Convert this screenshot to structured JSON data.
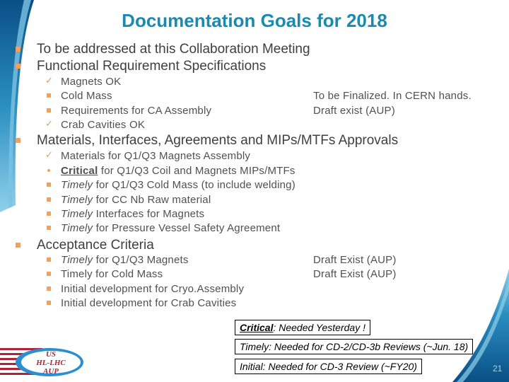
{
  "title": "Documentation Goals for 2018",
  "sections": [
    {
      "label": "To be addressed at this Collaboration Meeting",
      "bullet": "square"
    },
    {
      "label": "Functional Requirement Specifications",
      "bullet": "square",
      "items": [
        {
          "bullet": "check",
          "text": "Magnets OK",
          "note": ""
        },
        {
          "bullet": "square",
          "text": "Cold Mass",
          "note": "To be Finalized. In CERN hands."
        },
        {
          "bullet": "square",
          "text": "Requirements for CA Assembly",
          "note": "Draft exist (AUP)"
        },
        {
          "bullet": "check",
          "text": "Crab Cavities OK",
          "note": ""
        }
      ]
    },
    {
      "label": "Materials, Interfaces, Agreements and MIPs/MTFs Approvals",
      "bullet": "square",
      "items": [
        {
          "bullet": "check",
          "prefix": "",
          "text": "Materials for Q1/Q3 Magnets Assembly"
        },
        {
          "bullet": "dot",
          "prefix": "Critical",
          "prefix_style": "bold-underline",
          "text": " for Q1/Q3 Coil and Magnets MIPs/MTFs"
        },
        {
          "bullet": "square",
          "prefix": "Timely",
          "prefix_style": "italic",
          "text": " for Q1/Q3 Cold Mass (to include welding)"
        },
        {
          "bullet": "square",
          "prefix": "Timely",
          "prefix_style": "italic",
          "text": " for CC Nb Raw material"
        },
        {
          "bullet": "square",
          "prefix": "Timely",
          "prefix_style": "italic",
          "text": " Interfaces for Magnets"
        },
        {
          "bullet": "square",
          "prefix": "Timely",
          "prefix_style": "italic",
          "text": " for Pressure Vessel Safety Agreement"
        }
      ]
    },
    {
      "label": "Acceptance Criteria",
      "bullet": "square",
      "items": [
        {
          "bullet": "square",
          "prefix": "Timely",
          "prefix_style": "italic",
          "text": " for Q1/Q3 Magnets",
          "note": "Draft Exist (AUP)"
        },
        {
          "bullet": "square",
          "prefix": "",
          "text": "Timely for Cold Mass",
          "note": "Draft Exist (AUP)"
        },
        {
          "bullet": "square",
          "prefix": "",
          "text": "Initial development for Cryo.Assembly",
          "note": ""
        },
        {
          "bullet": "square",
          "prefix": "",
          "text": "Initial development for Crab Cavities",
          "note": ""
        }
      ]
    }
  ],
  "legend": {
    "critical": {
      "term": "Critical",
      "text": ": Needed Yesterday !"
    },
    "timely": {
      "text": "Timely: Needed for CD-2/CD-3b Reviews (~Jun. 18)"
    },
    "initial": {
      "text": "Initial: Needed for CD-3 Review (~FY20)"
    }
  },
  "logo": {
    "line1": "US",
    "line2": "HL-LHC",
    "line3": "AUP"
  },
  "page_number": "21",
  "colors": {
    "title": "#1a8ab0",
    "bullet": "#f0a060",
    "accent_blue": "#1a6fa0"
  }
}
